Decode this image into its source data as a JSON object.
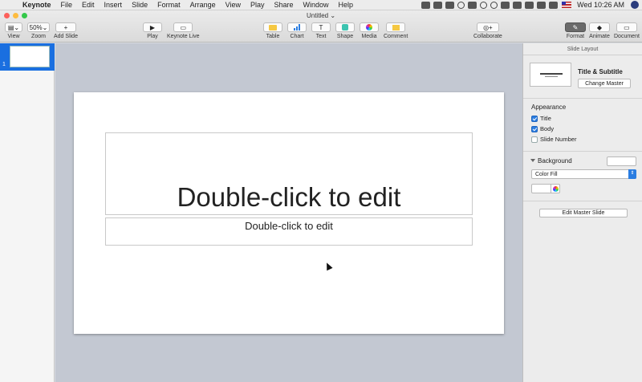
{
  "menubar": {
    "app_name": "Keynote",
    "items": [
      "File",
      "Edit",
      "Insert",
      "Slide",
      "Format",
      "Arrange",
      "View",
      "Play",
      "Share",
      "Window",
      "Help"
    ],
    "clock": "Wed 10:26 AM"
  },
  "window": {
    "title": "Untitled"
  },
  "toolbar": {
    "view_label": "View",
    "zoom_value": "50%",
    "zoom_label": "Zoom",
    "add_slide_label": "Add Slide",
    "play_label": "Play",
    "keynote_live_label": "Keynote Live",
    "table_label": "Table",
    "chart_label": "Chart",
    "text_label": "Text",
    "shape_label": "Shape",
    "media_label": "Media",
    "comment_label": "Comment",
    "collaborate_label": "Collaborate",
    "format_label": "Format",
    "animate_label": "Animate",
    "document_label": "Document"
  },
  "navigator": {
    "slide_number": "1"
  },
  "slide": {
    "title_placeholder": "Double-click to edit",
    "body_placeholder": "Double-click to edit"
  },
  "inspector": {
    "header": "Slide Layout",
    "master_name": "Title & Subtitle",
    "change_master_label": "Change Master",
    "appearance_title": "Appearance",
    "checks": [
      {
        "label": "Title",
        "checked": true
      },
      {
        "label": "Body",
        "checked": true
      },
      {
        "label": "Slide Number",
        "checked": false
      }
    ],
    "background_title": "Background",
    "fill_option": "Color Fill",
    "edit_master_label": "Edit Master Slide"
  },
  "colors": {
    "accent": "#2a7de1",
    "selection": "#1a6fe0",
    "close": "#fc605b",
    "minimize": "#fdbc40",
    "zoom": "#34c84a"
  }
}
